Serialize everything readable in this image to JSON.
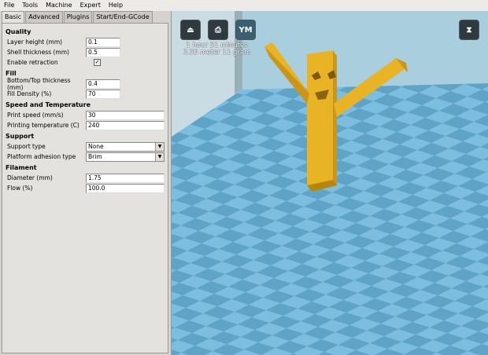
{
  "menu": [
    "File",
    "Tools",
    "Machine",
    "Expert",
    "Help"
  ],
  "tabs": [
    "Basic",
    "Advanced",
    "Plugins",
    "Start/End-GCode"
  ],
  "quality": {
    "title": "Quality",
    "layer_height_label": "Layer height (mm)",
    "layer_height": "0.1",
    "shell_label": "Shell thickness (mm)",
    "shell": "0.5",
    "retraction_label": "Enable retraction",
    "retraction_checked": true,
    "check": "✓"
  },
  "fill": {
    "title": "Fill",
    "bottom_top_label": "Bottom/Top thickness (mm)",
    "bottom_top": "0.4",
    "density_label": "Fill Density (%)",
    "density": "70"
  },
  "speed": {
    "title": "Speed and Temperature",
    "print_speed_label": "Print speed (mm/s)",
    "print_speed": "30",
    "temp_label": "Printing temperature (C)",
    "temp": "240"
  },
  "support": {
    "title": "Support",
    "type_label": "Support type",
    "type": "None",
    "adhesion_label": "Platform adhesion type",
    "adhesion": "Brim"
  },
  "filament": {
    "title": "Filament",
    "diameter_label": "Diameter (mm)",
    "diameter": "1.75",
    "flow_label": "Flow (%)",
    "flow": "100.0"
  },
  "viewport": {
    "ym_label": "YM",
    "time": "1 hour 51 minutes",
    "material": "3.55 meter 11 gram",
    "model_color": "#e8b425",
    "floor_light": "#7cbde0",
    "floor_dark": "#5fa3c6"
  }
}
